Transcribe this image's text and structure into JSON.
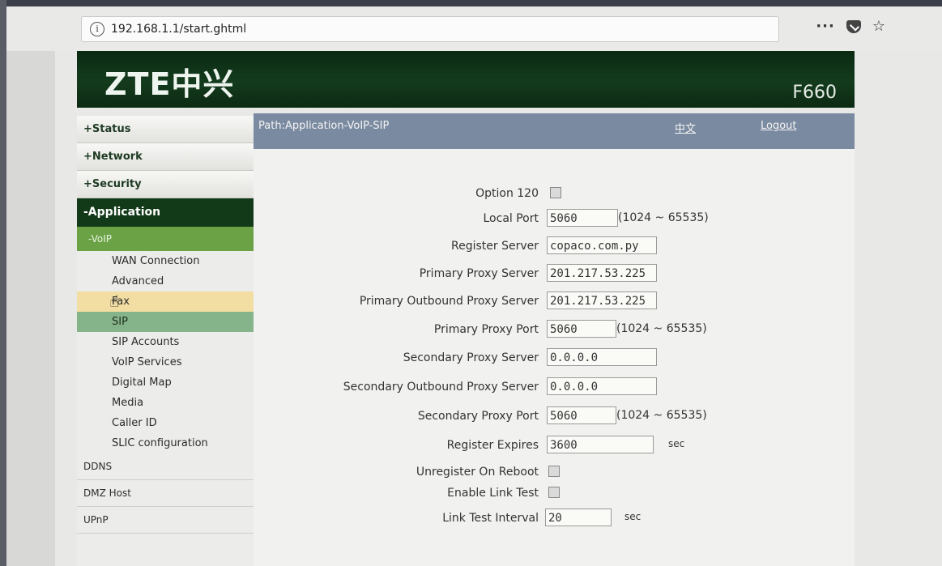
{
  "browser": {
    "url": "192.168.1.1/start.ghtml",
    "menu_glyph": "···",
    "bookmark_glyph": "☆"
  },
  "banner": {
    "logo": "ZTE中兴",
    "model": "F660"
  },
  "sidebar": {
    "top": [
      "+Status",
      "+Network",
      "+Security"
    ],
    "application": "-Application",
    "voip": "-VoIP",
    "voip_items": [
      "WAN Connection",
      "Advanced",
      "Fax",
      "SIP",
      "SIP Accounts",
      "VoIP Services",
      "Digital Map",
      "Media",
      "Caller ID",
      "SLIC configuration"
    ],
    "bottom": [
      "DDNS",
      "DMZ Host",
      "UPnP"
    ]
  },
  "pathbar": {
    "path": "Path:Application-VoIP-SIP",
    "lang": "中文",
    "logout": "Logout"
  },
  "form": {
    "option120_label": "Option 120",
    "local_port_label": "Local Port",
    "local_port_value": "5060",
    "port_range": "(1024 ~ 65535)",
    "register_server_label": "Register Server",
    "register_server_value": "copaco.com.py",
    "primary_proxy_server_label": "Primary Proxy Server",
    "primary_proxy_server_value": "201.217.53.225",
    "primary_outbound_label": "Primary Outbound Proxy Server",
    "primary_outbound_value": "201.217.53.225",
    "primary_proxy_port_label": "Primary Proxy Port",
    "primary_proxy_port_value": "5060",
    "secondary_proxy_server_label": "Secondary Proxy Server",
    "secondary_proxy_server_value": "0.0.0.0",
    "secondary_outbound_label": "Secondary Outbound Proxy Server",
    "secondary_outbound_value": "0.0.0.0",
    "secondary_proxy_port_label": "Secondary Proxy Port",
    "secondary_proxy_port_value": "5060",
    "register_expires_label": "Register Expires",
    "register_expires_value": "3600",
    "sec_unit": "sec",
    "unregister_label": "Unregister On Reboot",
    "link_test_label": "Enable Link Test",
    "link_interval_label": "Link Test Interval",
    "link_interval_value": "20"
  }
}
